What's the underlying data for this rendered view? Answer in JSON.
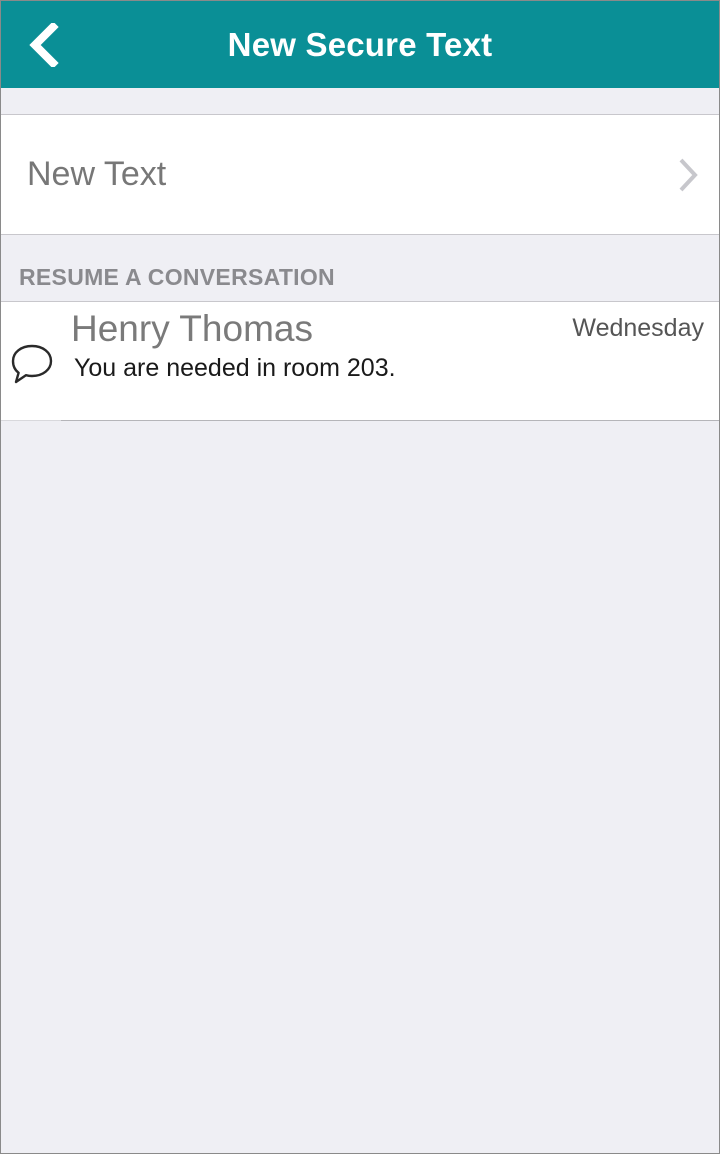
{
  "header": {
    "title": "New Secure Text",
    "back_icon": "chevron-left-icon",
    "background_color": "#0a8f96"
  },
  "new_text": {
    "label": "New Text",
    "chevron_icon": "chevron-right-icon"
  },
  "section": {
    "title": "RESUME A CONVERSATION"
  },
  "conversations": [
    {
      "name": "Henry Thomas",
      "date": "Wednesday",
      "message": "You are needed in room 203.",
      "icon": "chat-bubble-icon"
    }
  ]
}
